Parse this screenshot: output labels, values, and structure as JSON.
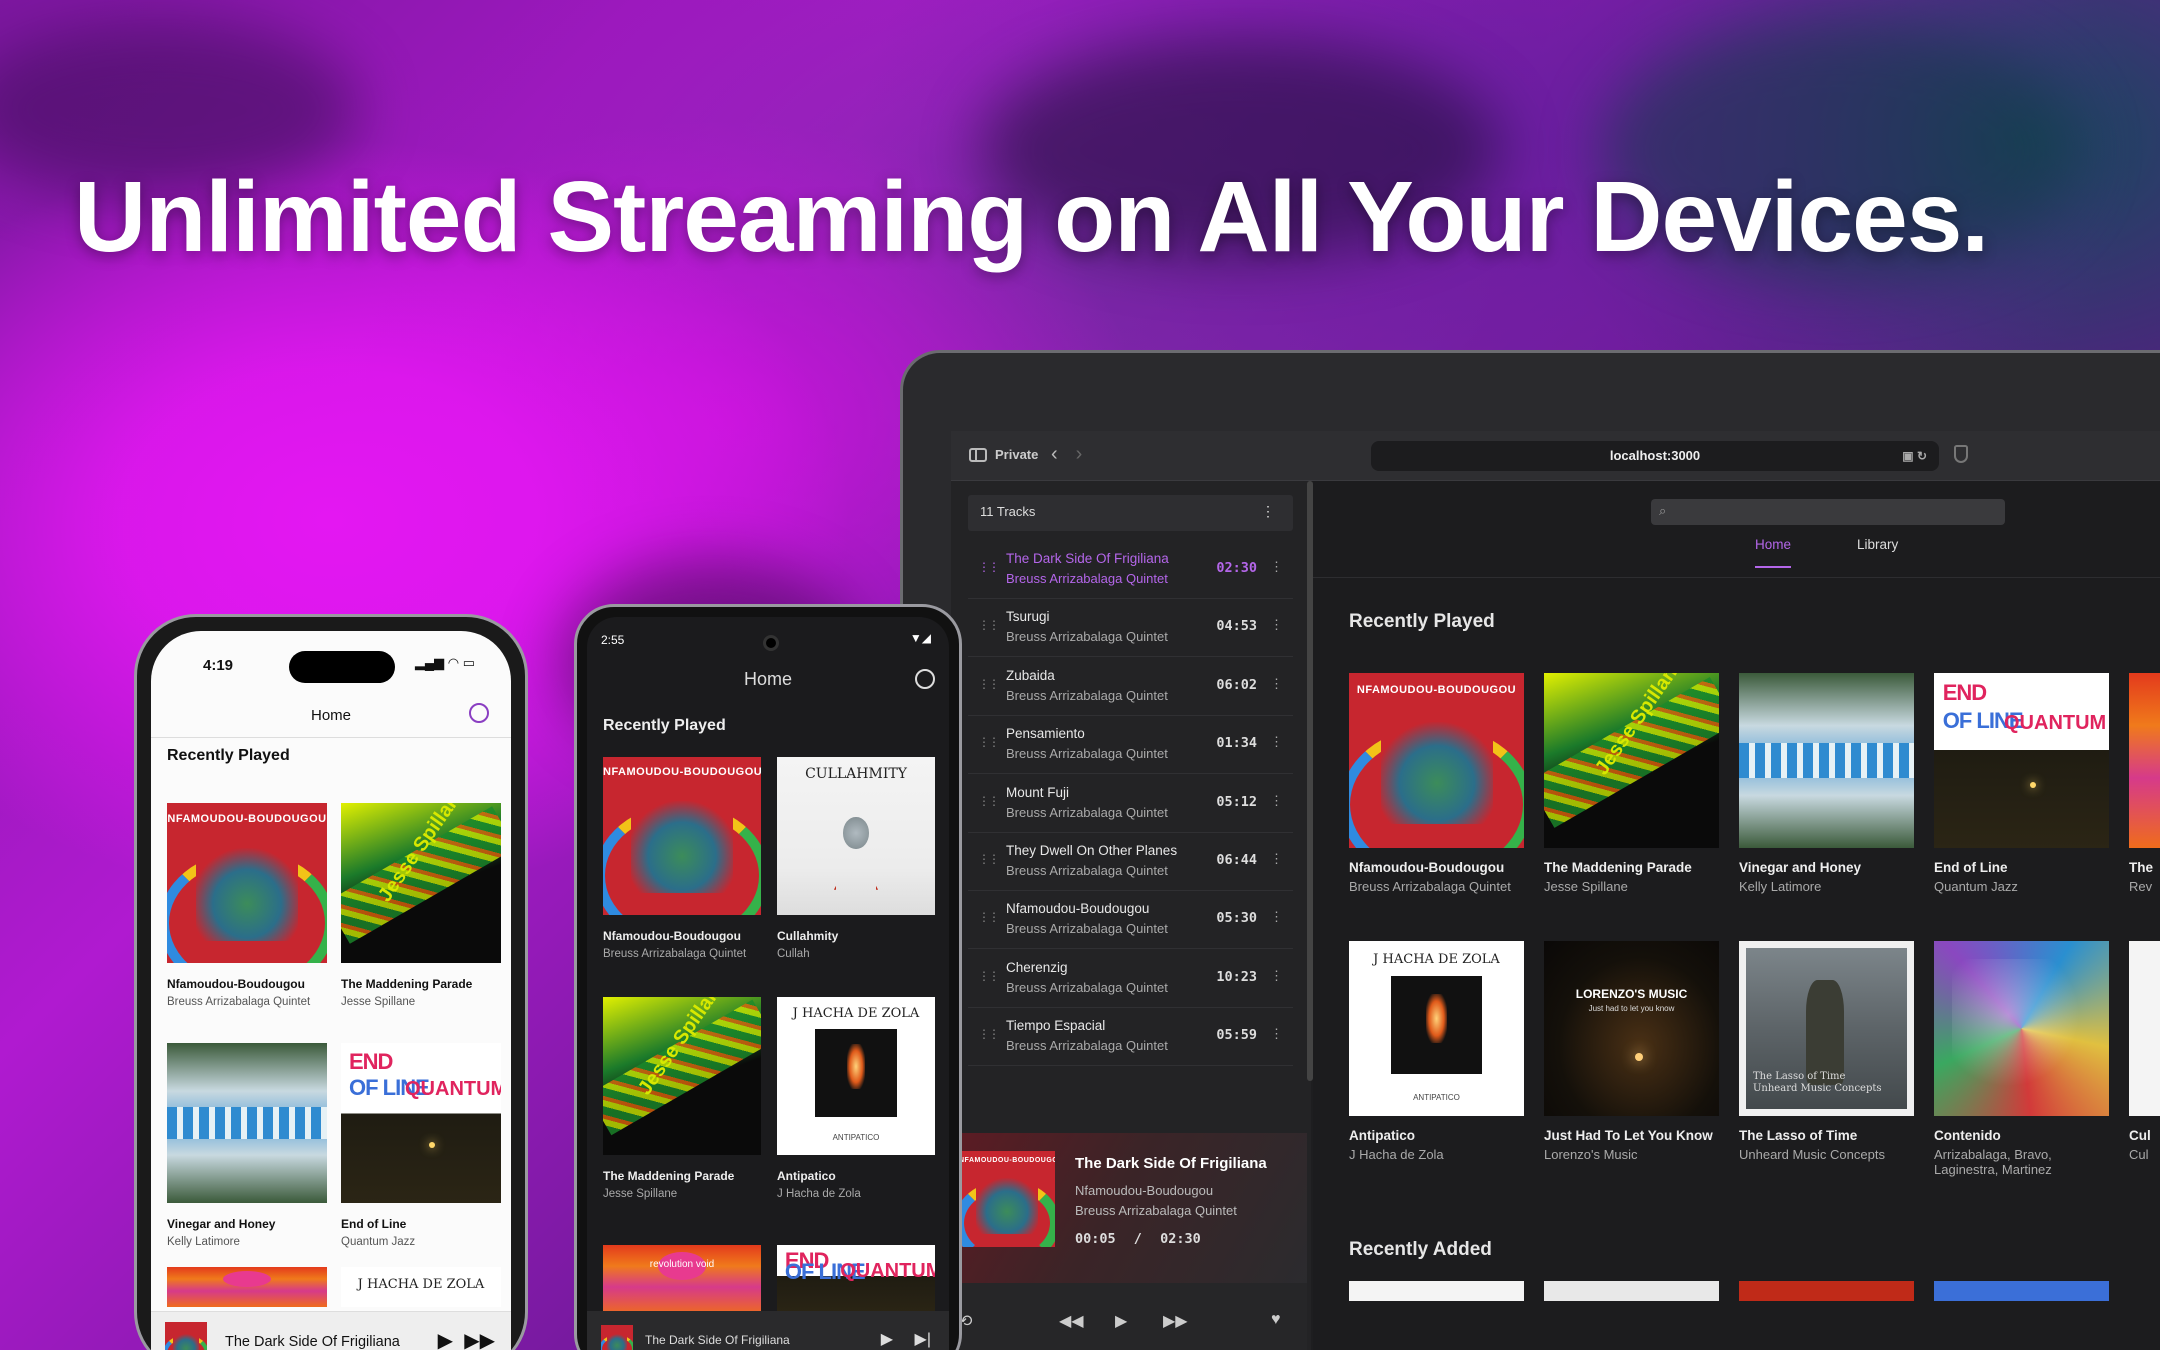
{
  "headline": "Unlimited Streaming on All Your Devices.",
  "laptop": {
    "browser": {
      "private_label": "Private",
      "url": "localhost:3000"
    },
    "queue": {
      "header": "11 Tracks",
      "tracks": [
        {
          "title": "The Dark Side Of Frigiliana",
          "artist": "Breuss Arrizabalaga Quintet",
          "duration": "02:30"
        },
        {
          "title": "Tsurugi",
          "artist": "Breuss Arrizabalaga Quintet",
          "duration": "04:53"
        },
        {
          "title": "Zubaida",
          "artist": "Breuss Arrizabalaga Quintet",
          "duration": "06:02"
        },
        {
          "title": "Pensamiento",
          "artist": "Breuss Arrizabalaga Quintet",
          "duration": "01:34"
        },
        {
          "title": "Mount Fuji",
          "artist": "Breuss Arrizabalaga Quintet",
          "duration": "05:12"
        },
        {
          "title": "They Dwell On Other Planes",
          "artist": "Breuss Arrizabalaga Quintet",
          "duration": "06:44"
        },
        {
          "title": "Nfamoudou-Boudougou",
          "artist": "Breuss Arrizabalaga Quintet",
          "duration": "05:30"
        },
        {
          "title": "Cherenzig",
          "artist": "Breuss Arrizabalaga Quintet",
          "duration": "10:23"
        },
        {
          "title": "Tiempo Espacial",
          "artist": "Breuss Arrizabalaga Quintet",
          "duration": "05:59"
        }
      ]
    },
    "now_playing": {
      "title": "The Dark Side Of Frigiliana",
      "album": "Nfamoudou-Boudougou",
      "artist": "Breuss Arrizabalaga Quintet",
      "elapsed": "00:05",
      "separator": "/",
      "total": "02:30"
    },
    "tabs": [
      "Home",
      "Library"
    ],
    "recently_played_title": "Recently Played",
    "recently_added_title": "Recently Added",
    "row1": [
      {
        "title": "Nfamoudou-Boudougou",
        "artist": "Breuss Arrizabalaga Quintet"
      },
      {
        "title": "The Maddening Parade",
        "artist": "Jesse Spillane"
      },
      {
        "title": "Vinegar and Honey",
        "artist": "Kelly Latimore"
      },
      {
        "title": "End of Line",
        "artist": "Quantum Jazz"
      },
      {
        "title": "The",
        "artist": "Rev"
      }
    ],
    "row2": [
      {
        "title": "Antipatico",
        "artist": "J Hacha de Zola"
      },
      {
        "title": "Just Had To Let You Know",
        "artist": "Lorenzo's Music"
      },
      {
        "title": "The Lasso of Time",
        "artist": "Unheard Music Concepts"
      },
      {
        "title": "Contenido",
        "artist": "Arrizabalaga, Bravo, Laginestra, Martinez"
      },
      {
        "title": "Cul",
        "artist": "Cul"
      }
    ]
  },
  "iphone": {
    "time": "4:19",
    "header": "Home",
    "section": "Recently Played",
    "cards": [
      {
        "title": "Nfamoudou-Boudougou",
        "artist": "Breuss Arrizabalaga Quintet"
      },
      {
        "title": "The Maddening Parade",
        "artist": "Jesse Spillane"
      },
      {
        "title": "Vinegar and Honey",
        "artist": "Kelly Latimore"
      },
      {
        "title": "End of Line",
        "artist": "Quantum Jazz"
      }
    ],
    "mini_player_title": "The Dark Side Of Frigiliana"
  },
  "android": {
    "time": "2:55",
    "header": "Home",
    "section": "Recently Played",
    "cards": [
      {
        "title": "Nfamoudou-Boudougou",
        "artist": "Breuss Arrizabalaga Quintet"
      },
      {
        "title": "Cullahmity",
        "artist": "Cullah"
      },
      {
        "title": "The Maddening Parade",
        "artist": "Jesse Spillane"
      },
      {
        "title": "Antipatico",
        "artist": "J Hacha de Zola"
      }
    ],
    "mini_player_title": "The Dark Side Of Frigiliana"
  },
  "art_text": {
    "nfam": "NFAMOUDOU-BOUDOUGOU",
    "madd": "Jesse Spillane",
    "end_1": "END",
    "end_2": "OF LINE",
    "end_3": "QUANTUM JAZZ",
    "anti": "J HACHA DE ZOLA",
    "anti_sub": "ANTIPATICO",
    "cull": "CULLAHMITY",
    "lor": "LORENZO'S MUSIC",
    "lor_sub": "Just had to let you know",
    "lasso_1": "The Lasso of Time",
    "lasso_2": "Unheard Music Concepts",
    "rev": "revolution void"
  },
  "colors": {
    "accent": "#b466ea",
    "background_magenta": "#e417f2",
    "dark_surface": "#1c1c1e"
  }
}
